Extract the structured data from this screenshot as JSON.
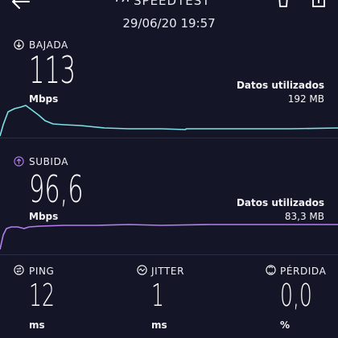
{
  "header": {
    "title": "SPEEDTEST",
    "datetime": "29/06/20 19:57"
  },
  "download": {
    "label": "BAJADA",
    "value": "113",
    "unit": "Mbps",
    "data_used_label": "Datos utilizados",
    "data_used_value": "192 MB",
    "color": "#7ee0e6"
  },
  "upload": {
    "label": "SUBIDA",
    "value": "96,6",
    "unit": "Mbps",
    "data_used_label": "Datos utilizados",
    "data_used_value": "83,3 MB",
    "color": "#b77cf2"
  },
  "ping": {
    "label": "PING",
    "value": "12",
    "unit": "ms"
  },
  "jitter": {
    "label": "JITTER",
    "value": "1",
    "unit": "ms"
  },
  "loss": {
    "label": "PÉRDIDA",
    "value": "0,0",
    "unit": "%"
  },
  "icons": {
    "back": "arrow-left-icon",
    "speedtest": "speedtest-gauge-icon",
    "delete": "trash-icon",
    "share": "share-icon",
    "download": "arrow-down-circle-icon",
    "upload": "arrow-up-circle-icon",
    "ping": "ping-icon",
    "jitter": "jitter-icon",
    "loss": "loss-icon"
  }
}
